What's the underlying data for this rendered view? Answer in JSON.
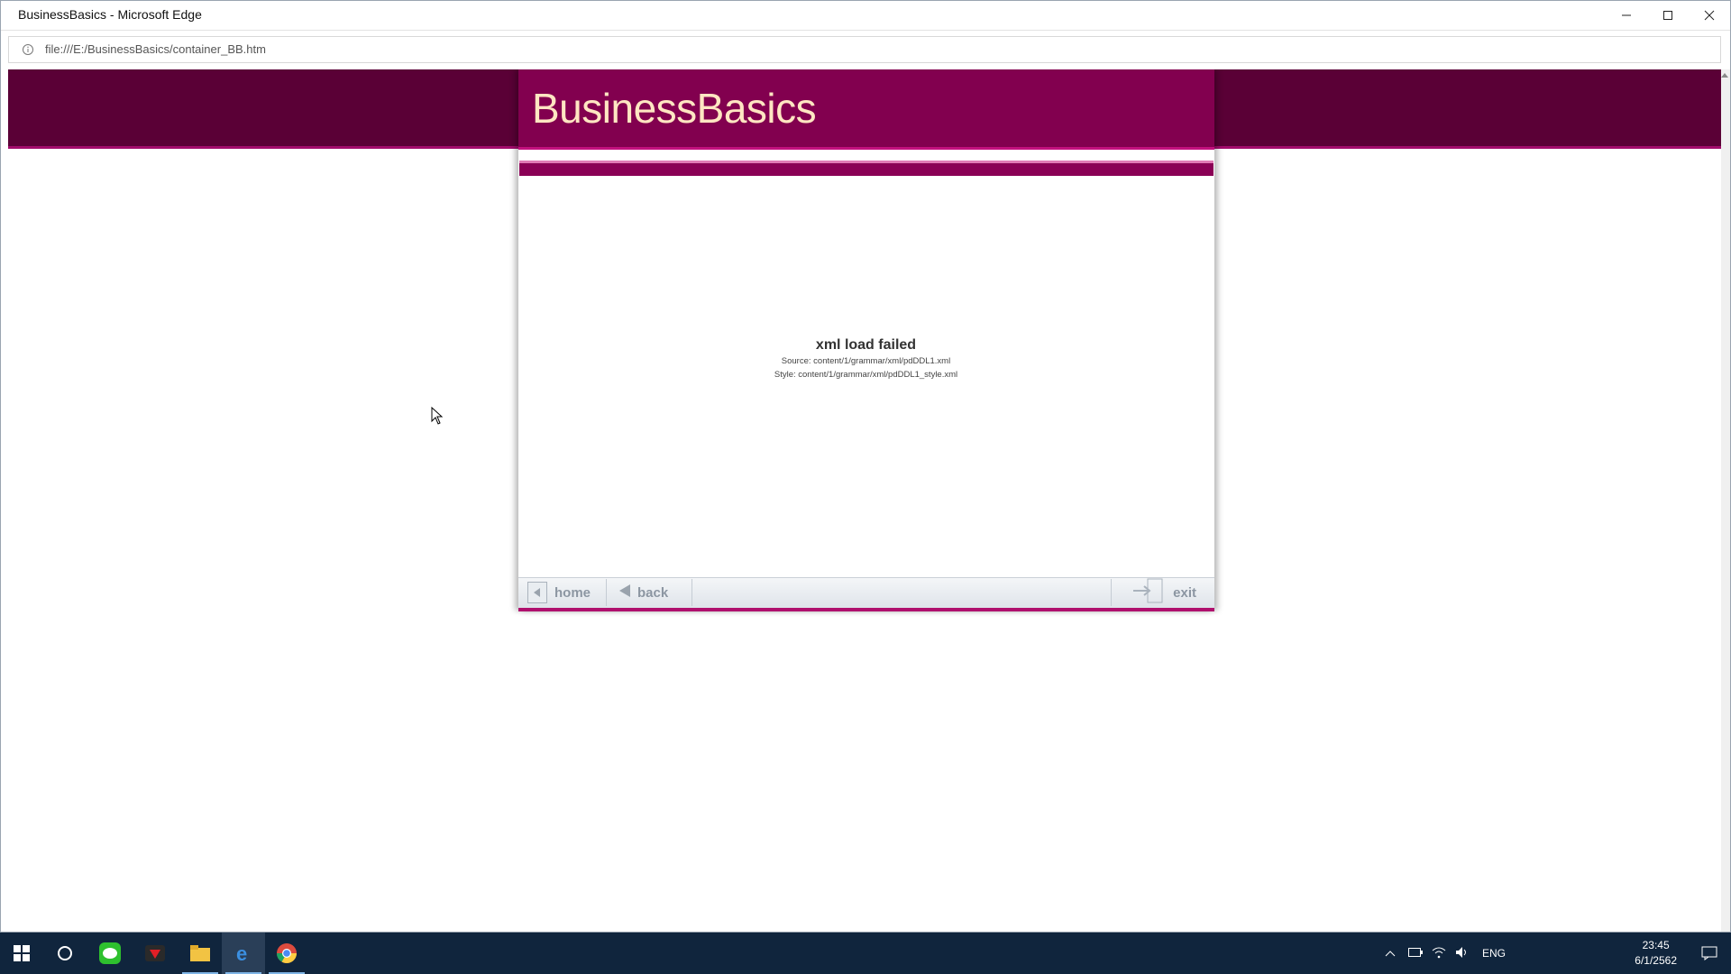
{
  "window": {
    "title": "BusinessBasics - Microsoft Edge",
    "url": "file:///E:/BusinessBasics/container_BB.htm"
  },
  "app": {
    "logo": "BusinessBasics",
    "error": {
      "title": "xml load failed",
      "source": "Source: content/1/grammar/xml/pdDDL1.xml",
      "style": "Style: content/1/grammar/xml/pdDDL1_style.xml"
    },
    "nav": {
      "home": "home",
      "back": "back",
      "exit": "exit"
    }
  },
  "taskbar": {
    "icons": [
      "windows-start-icon",
      "search-circle-icon",
      "line-app-icon",
      "game-app-icon",
      "file-explorer-icon",
      "edge-icon",
      "chrome-icon"
    ],
    "language": "ENG",
    "time": "23:45",
    "date": "6/1/2562"
  },
  "colors": {
    "header_dark": "#5a0036",
    "header_brand": "#82004f",
    "accent_pink": "#c2107d",
    "logo_text": "#ffe6c2",
    "taskbar": "#10253d"
  }
}
